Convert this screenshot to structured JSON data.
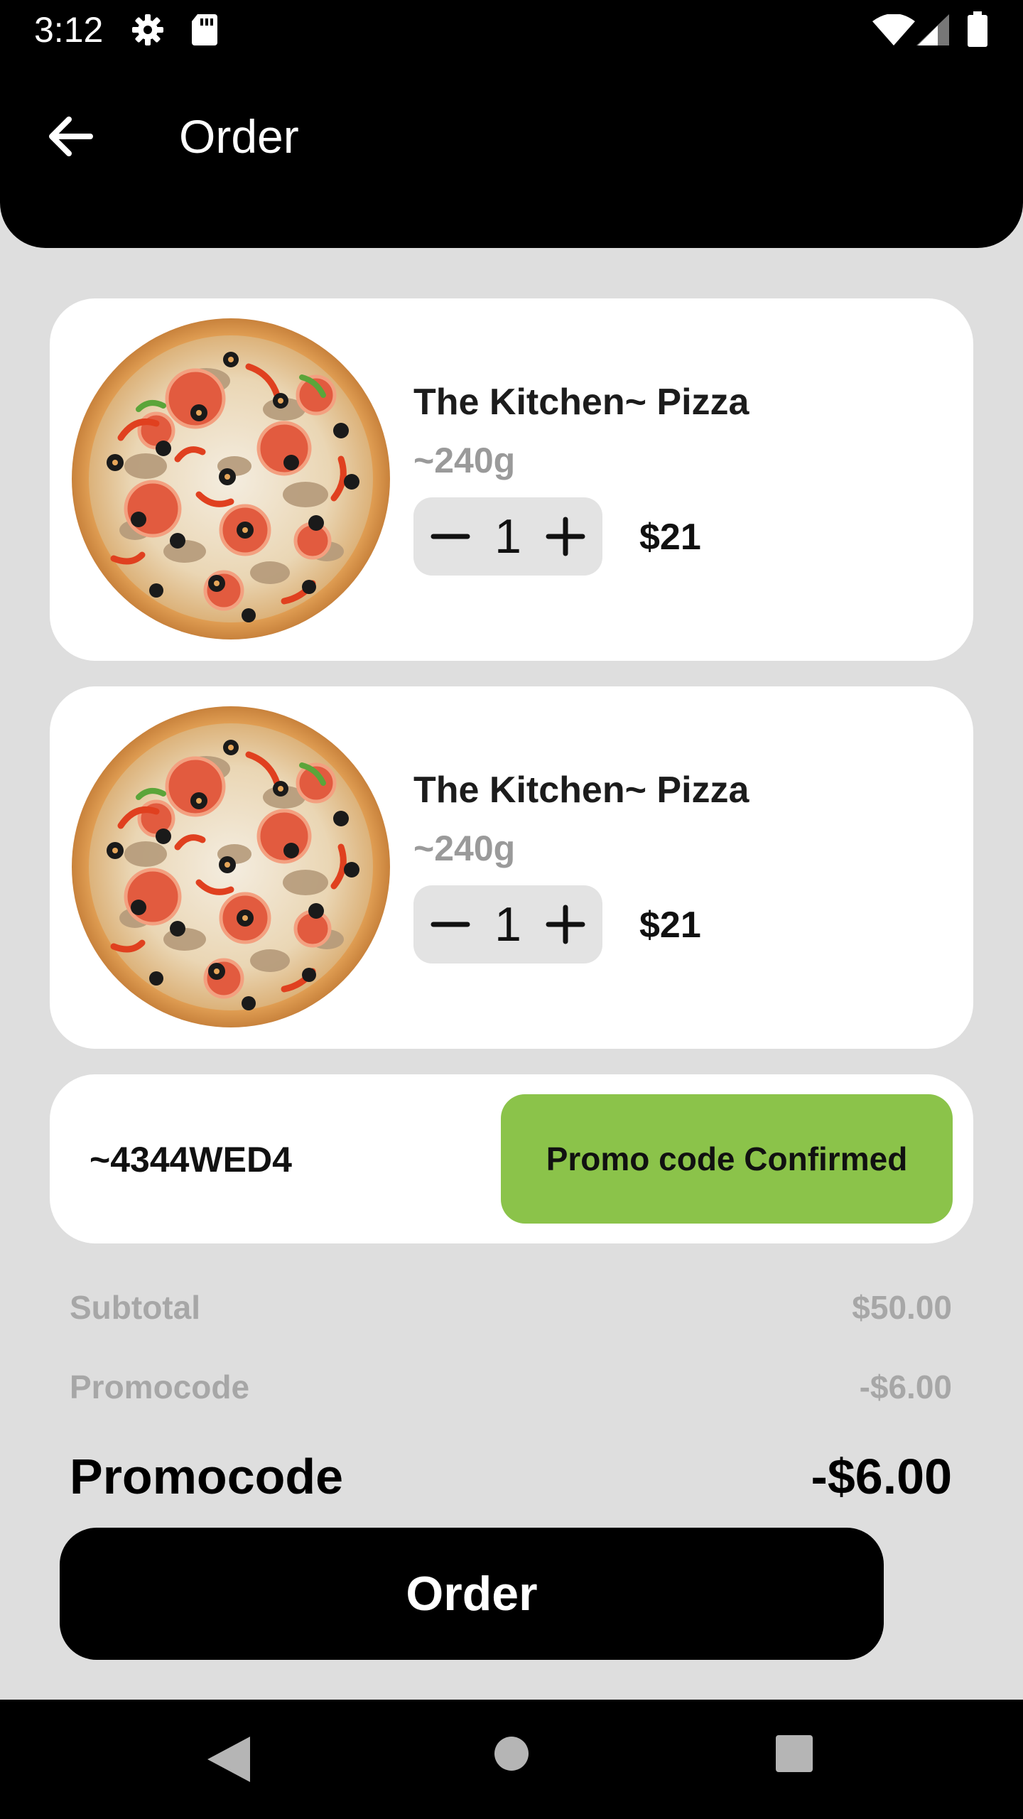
{
  "status_bar": {
    "time": "3:12",
    "icons": [
      "gear-icon",
      "sd-card-icon",
      "wifi-icon",
      "signal-icon",
      "battery-icon"
    ]
  },
  "header": {
    "title": "Order",
    "back_icon": "arrow-left-icon"
  },
  "cart": {
    "items": [
      {
        "name": "The Kitchen~ Pizza",
        "weight": "~240g",
        "quantity": "1",
        "price": "$21",
        "image": "pizza-image"
      },
      {
        "name": "The Kitchen~ Pizza",
        "weight": "~240g",
        "quantity": "1",
        "price": "$21",
        "image": "pizza-image"
      }
    ]
  },
  "promo": {
    "code": "~4344WED4",
    "button_label": "Promo code Confirmed",
    "button_color": "#8bc34a"
  },
  "summary": {
    "subtotal_label": "Subtotal",
    "subtotal_value": "$50.00",
    "promocode_label": "Promocode",
    "promocode_value": "-$6.00",
    "total_label": "Promocode",
    "total_value": "-$6.00"
  },
  "order_button": {
    "label": "Order"
  },
  "nav_bar": {
    "icons": [
      "nav-back-icon",
      "nav-home-icon",
      "nav-recents-icon"
    ]
  },
  "colors": {
    "background": "#dedede",
    "header": "#000000",
    "card": "#ffffff",
    "accent": "#8bc34a",
    "muted_text": "#9a9a9a"
  }
}
